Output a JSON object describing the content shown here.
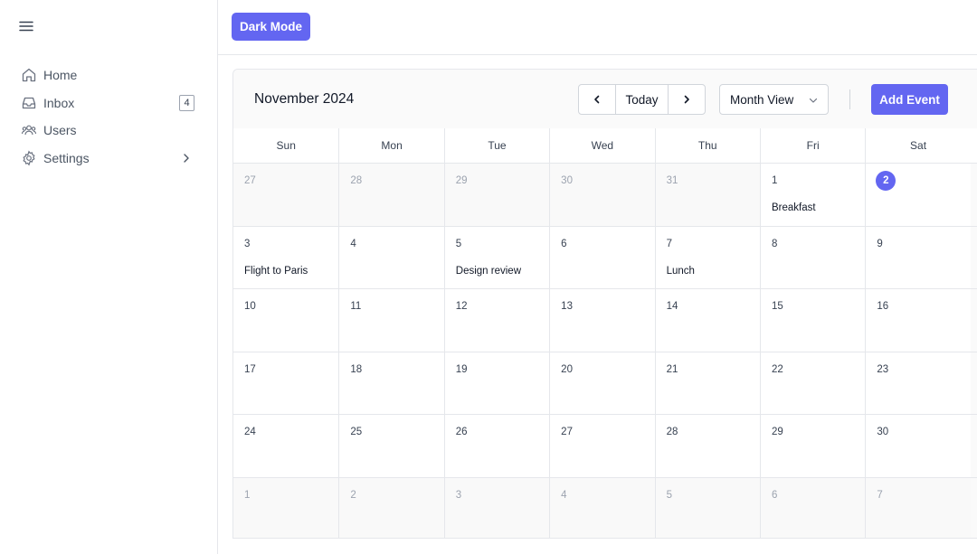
{
  "sidebar": {
    "items": [
      {
        "label": "Home",
        "icon": "home-icon"
      },
      {
        "label": "Inbox",
        "icon": "inbox-icon",
        "badge": "4"
      },
      {
        "label": "Users",
        "icon": "users-icon"
      },
      {
        "label": "Settings",
        "icon": "gear-icon"
      }
    ]
  },
  "topbar": {
    "dark_mode_label": "Dark Mode"
  },
  "calendar": {
    "title": "November 2024",
    "today_label": "Today",
    "view_select_value": "Month View",
    "add_event_label": "Add Event",
    "weekdays": [
      "Sun",
      "Mon",
      "Tue",
      "Wed",
      "Thu",
      "Fri",
      "Sat"
    ],
    "weeks": [
      [
        {
          "n": "27",
          "o": true
        },
        {
          "n": "28",
          "o": true
        },
        {
          "n": "29",
          "o": true
        },
        {
          "n": "30",
          "o": true
        },
        {
          "n": "31",
          "o": true
        },
        {
          "n": "1",
          "e": "Breakfast"
        },
        {
          "n": "2",
          "t": true
        }
      ],
      [
        {
          "n": "3",
          "e": "Flight to Paris"
        },
        {
          "n": "4"
        },
        {
          "n": "5",
          "e": "Design review"
        },
        {
          "n": "6"
        },
        {
          "n": "7",
          "e": "Lunch"
        },
        {
          "n": "8"
        },
        {
          "n": "9"
        }
      ],
      [
        {
          "n": "10"
        },
        {
          "n": "11"
        },
        {
          "n": "12"
        },
        {
          "n": "13"
        },
        {
          "n": "14"
        },
        {
          "n": "15"
        },
        {
          "n": "16"
        }
      ],
      [
        {
          "n": "17"
        },
        {
          "n": "18"
        },
        {
          "n": "19"
        },
        {
          "n": "20"
        },
        {
          "n": "21"
        },
        {
          "n": "22"
        },
        {
          "n": "23"
        }
      ],
      [
        {
          "n": "24"
        },
        {
          "n": "25"
        },
        {
          "n": "26"
        },
        {
          "n": "27"
        },
        {
          "n": "28"
        },
        {
          "n": "29"
        },
        {
          "n": "30"
        }
      ],
      [
        {
          "n": "1",
          "o": true
        },
        {
          "n": "2",
          "o": true
        },
        {
          "n": "3",
          "o": true
        },
        {
          "n": "4",
          "o": true
        },
        {
          "n": "5",
          "o": true
        },
        {
          "n": "6",
          "o": true
        },
        {
          "n": "7",
          "o": true
        }
      ]
    ]
  },
  "colors": {
    "accent": "#6366f1",
    "border": "#e5e7eb",
    "muted_text": "#9ca3af"
  }
}
